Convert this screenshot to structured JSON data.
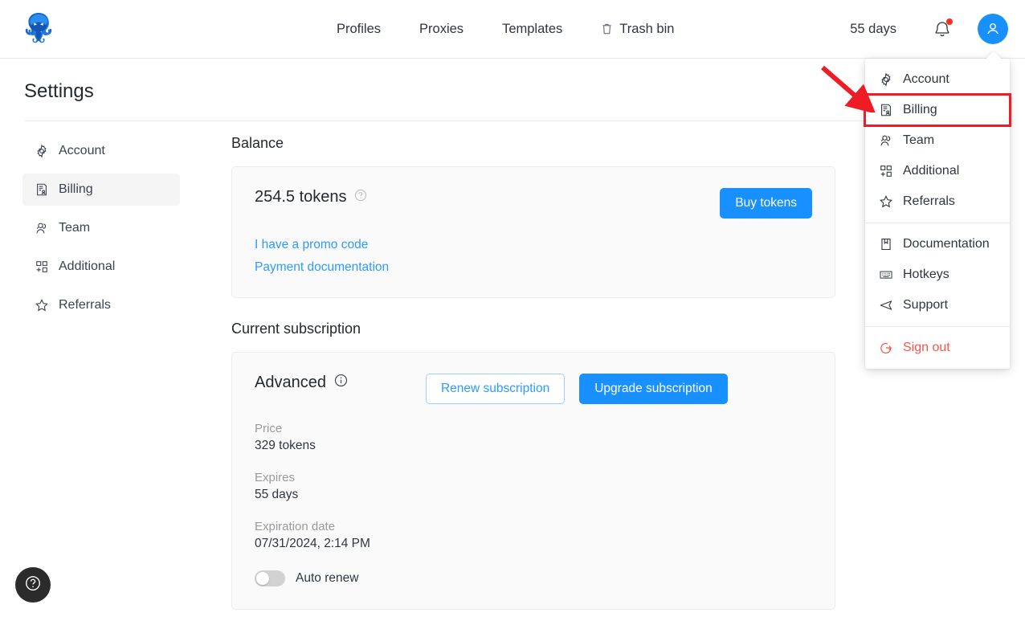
{
  "header": {
    "logo_icon": "octopus-logo",
    "nav": [
      {
        "label": "Profiles",
        "icon": null
      },
      {
        "label": "Proxies",
        "icon": null
      },
      {
        "label": "Templates",
        "icon": null
      },
      {
        "label": "Trash bin",
        "icon": "trash-icon"
      }
    ],
    "days_label": "55 days",
    "bell_icon": "bell-icon",
    "has_notification": true,
    "avatar_icon": "user-avatar-icon",
    "avatar_color": "#1890ff"
  },
  "dropdown": {
    "group1": [
      {
        "label": "Account",
        "icon": "gear-icon",
        "highlighted": false
      },
      {
        "label": "Billing",
        "icon": "billing-icon",
        "highlighted": true
      },
      {
        "label": "Team",
        "icon": "team-icon",
        "highlighted": false
      },
      {
        "label": "Additional",
        "icon": "grid-plus-icon",
        "highlighted": false
      },
      {
        "label": "Referrals",
        "icon": "star-icon",
        "highlighted": false
      }
    ],
    "group2": [
      {
        "label": "Documentation",
        "icon": "bookmark-icon"
      },
      {
        "label": "Hotkeys",
        "icon": "keyboard-icon"
      },
      {
        "label": "Support",
        "icon": "send-icon"
      }
    ],
    "signout": {
      "label": "Sign out",
      "icon": "logout-icon",
      "color": "#f5554a"
    },
    "highlight_color": "#ee1c25",
    "annotation_arrow_color": "#ee1c25"
  },
  "page": {
    "title": "Settings"
  },
  "sidebar": {
    "items": [
      {
        "label": "Account",
        "icon": "gear-icon",
        "active": false
      },
      {
        "label": "Billing",
        "icon": "billing-icon",
        "active": true
      },
      {
        "label": "Team",
        "icon": "team-icon",
        "active": false
      },
      {
        "label": "Additional",
        "icon": "grid-plus-icon",
        "active": false
      },
      {
        "label": "Referrals",
        "icon": "star-icon",
        "active": false
      }
    ]
  },
  "balance": {
    "section_title": "Balance",
    "tokens": "254.5 tokens",
    "help_icon": "question-circle-icon",
    "buy_button": "Buy tokens",
    "links": [
      "I have a promo code",
      "Payment documentation"
    ]
  },
  "subscription": {
    "section_title": "Current subscription",
    "plan": "Advanced",
    "info_icon": "info-circle-icon",
    "renew_button": "Renew subscription",
    "upgrade_button": "Upgrade subscription",
    "fields": [
      {
        "label": "Price",
        "value": "329 tokens"
      },
      {
        "label": "Expires",
        "value": "55 days"
      },
      {
        "label": "Expiration date",
        "value": "07/31/2024, 2:14 PM"
      }
    ],
    "auto_renew": {
      "label": "Auto renew",
      "enabled": false
    }
  },
  "help_fab": {
    "icon": "question-circle-icon"
  },
  "theme": {
    "accent": "#1890ff",
    "link": "#2e9bff",
    "danger": "#f5554a",
    "card_bg": "#fafafa",
    "card_border": "#ececec"
  }
}
